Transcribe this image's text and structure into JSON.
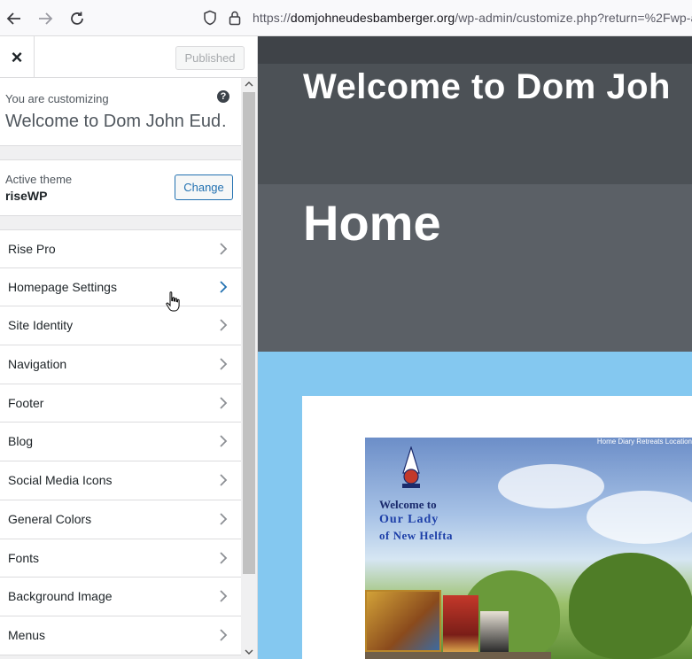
{
  "browser": {
    "url_prefix": "https://",
    "url_domain": "domjohneudesbamberger.org",
    "url_rest": "/wp-admin/customize.php?return=%2Fwp-a",
    "icons": [
      "back-arrow-icon",
      "forward-arrow-icon",
      "reload-icon",
      "shield-icon",
      "lock-icon"
    ]
  },
  "customizer": {
    "close_label": "×",
    "publish_label": "Published",
    "customizing_label": "You are customizing",
    "site_title": "Welcome to Dom John Eud…",
    "help_label": "?",
    "active_theme_label": "Active theme",
    "theme_name": "riseWP",
    "change_label": "Change",
    "menu": [
      {
        "label": "Rise Pro"
      },
      {
        "label": "Homepage Settings"
      },
      {
        "label": "Site Identity"
      },
      {
        "label": "Navigation"
      },
      {
        "label": "Footer"
      },
      {
        "label": "Blog"
      },
      {
        "label": "Social Media Icons"
      },
      {
        "label": "General Colors"
      },
      {
        "label": "Fonts"
      },
      {
        "label": "Background Image"
      },
      {
        "label": "Menus"
      }
    ]
  },
  "preview": {
    "welcome": "Welcome to Dom Joh",
    "home": "Home",
    "image_text_1": "Welcome to",
    "image_text_2": "Our Lady",
    "image_text_3": "of New Helfta",
    "image_nav": "Home    Diary    Retreats   Location"
  },
  "colors": {
    "accent": "#2271b1",
    "preview_bg": "#84c8f0",
    "dark_header": "#4c5156"
  }
}
